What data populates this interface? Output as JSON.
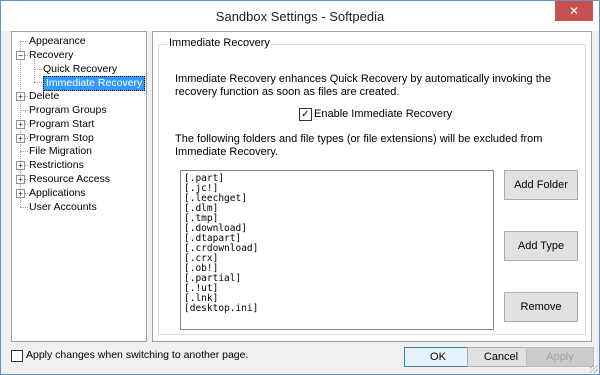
{
  "window": {
    "title": "Sandbox Settings - Softpedia",
    "close_glyph": "✕"
  },
  "tree": {
    "items": [
      {
        "label": "Appearance",
        "toggle": "",
        "level": 0
      },
      {
        "label": "Recovery",
        "toggle": "−",
        "level": 0
      },
      {
        "label": "Quick Recovery",
        "toggle": "",
        "level": 1
      },
      {
        "label": "Immediate Recovery",
        "toggle": "",
        "level": 1,
        "selected": true
      },
      {
        "label": "Delete",
        "toggle": "+",
        "level": 0
      },
      {
        "label": "Program Groups",
        "toggle": "",
        "level": 0
      },
      {
        "label": "Program Start",
        "toggle": "+",
        "level": 0
      },
      {
        "label": "Program Stop",
        "toggle": "+",
        "level": 0
      },
      {
        "label": "File Migration",
        "toggle": "",
        "level": 0
      },
      {
        "label": "Restrictions",
        "toggle": "+",
        "level": 0
      },
      {
        "label": "Resource Access",
        "toggle": "+",
        "level": 0
      },
      {
        "label": "Applications",
        "toggle": "+",
        "level": 0
      },
      {
        "label": "User Accounts",
        "toggle": "",
        "level": 0
      }
    ]
  },
  "panel": {
    "group_title": "Immediate Recovery",
    "description": "Immediate Recovery enhances Quick Recovery by automatically invoking the recovery function as soon as files are created.",
    "enable_checkbox": {
      "label": "Enable Immediate Recovery",
      "checked": true,
      "glyph": "✓"
    },
    "exclusion_text": "The following folders and file types (or file extensions) will be excluded from Immediate Recovery.",
    "exclusions": [
      "[.part]",
      "[.jc!]",
      "[.leechget]",
      "[.dlm]",
      "[.tmp]",
      "[.download]",
      "[.dtapart]",
      "[.crdownload]",
      "[.crx]",
      "[.ob!]",
      "[.partial]",
      "[.!ut]",
      "[.lnk]",
      "[desktop.ini]"
    ],
    "buttons": {
      "add_folder": "Add Folder",
      "add_type": "Add Type",
      "remove": "Remove"
    }
  },
  "footer": {
    "apply_on_switch_label": "Apply changes when switching to another page.",
    "apply_on_switch_checked": false,
    "ok": "OK",
    "cancel": "Cancel",
    "apply": "Apply"
  }
}
